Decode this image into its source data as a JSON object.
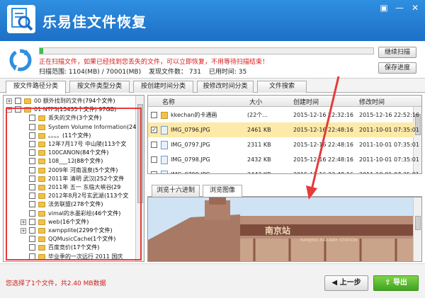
{
  "app": {
    "title": "乐易佳文件恢复"
  },
  "window_buttons": [
    "▣",
    "—",
    "✕"
  ],
  "scan": {
    "progress_percent": 1,
    "message": "正在扫描文件，如果已经找到您丢失的文件，可以立即恢复，不用等待扫描结束！",
    "scanned": "扫描范围: 1104(MB) / 70001(MB)",
    "found": "发现文件数：  731",
    "elapsed": "已用时间: 35",
    "btn_continue": "继续扫描",
    "btn_save": "保存进度"
  },
  "tabs": [
    "按文件路径分类",
    "按文件类型分类",
    "按创建时间分类",
    "按修改时间分类",
    "文件搜索"
  ],
  "tree": [
    {
      "indent": 0,
      "exp": "+",
      "label": "00  额外找到的文件",
      "count": "  (794个文件)"
    },
    {
      "indent": 0,
      "exp": "−",
      "label": "01  NTFS",
      "count": "  (15435个文件) 97GB)"
    },
    {
      "indent": 1,
      "exp": "",
      "label": "丢失的文件",
      "count": "  (3个文件)"
    },
    {
      "indent": 1,
      "exp": "",
      "label": "System Volume Information",
      "count": "  (24"
    },
    {
      "indent": 1,
      "exp": "",
      "label": "。。。。",
      "count": "  (11个文件)"
    },
    {
      "indent": 1,
      "exp": "",
      "label": "12年7月17号  中山陵",
      "count": "  (113个文"
    },
    {
      "indent": 1,
      "exp": "",
      "label": "100CANON",
      "count": "  (84个文件)"
    },
    {
      "indent": 1,
      "exp": "",
      "label": "108___12",
      "count": "  (88个文件)"
    },
    {
      "indent": 1,
      "exp": "",
      "label": "2009年 河南温泉",
      "count": "  (5个文件)"
    },
    {
      "indent": 1,
      "exp": "",
      "label": "2011年 清明  武汉",
      "count": "  (252个文件"
    },
    {
      "indent": 1,
      "exp": "",
      "label": "2011年 五一  东临大峡谷",
      "count": "  (29"
    },
    {
      "indent": 1,
      "exp": "",
      "label": "2012年8月2号玄武湖",
      "count": "  (113个文"
    },
    {
      "indent": 1,
      "exp": "",
      "label": "法务联盟",
      "count": "  (278个文件)"
    },
    {
      "indent": 1,
      "exp": "",
      "label": "vimal的水墨彩绘",
      "count": "  (46个文件)"
    },
    {
      "indent": 1,
      "exp": "+",
      "label": "web",
      "count": "  (16个文件)"
    },
    {
      "indent": 1,
      "exp": "+",
      "label": "xampplite",
      "count": "  (2299个文件)"
    },
    {
      "indent": 1,
      "exp": "",
      "label": "QQMusicCache",
      "count": "  (1个文件)"
    },
    {
      "indent": 1,
      "exp": "",
      "label": "百度竞价",
      "count": "  (17个文件)"
    },
    {
      "indent": 1,
      "exp": "",
      "label": "毕业季的一次远行 2011 国庆",
      "count": ""
    }
  ],
  "filelist": {
    "headers": [
      "名称",
      "大小",
      "创建时间",
      "修改时间"
    ],
    "rows": [
      {
        "name": "kkechan的卡通画",
        "size": "(22个...",
        "created": "2015-12-16  22:32:16",
        "modified": "2015-12-16  22:52:16",
        "type": "folder",
        "selected": false
      },
      {
        "name": "IMG_0796.JPG",
        "size": "2461 KB",
        "created": "2015-12-16  22:48:16",
        "modified": "2011-10-01  07:35:01",
        "type": "file",
        "selected": true
      },
      {
        "name": "IMG_0797.JPG",
        "size": "2311 KB",
        "created": "2015-12-16  22:48:16",
        "modified": "2011-10-01  07:35:01",
        "type": "file",
        "selected": false
      },
      {
        "name": "IMG_0798.JPG",
        "size": "2432 KB",
        "created": "2015-12-16  22:48:16",
        "modified": "2011-10-01  07:35:01",
        "type": "file",
        "selected": false
      },
      {
        "name": "IMG_0799.JPG",
        "size": "2442 KB",
        "created": "2015-12-16  22:48:16",
        "modified": "2011-10-01  07:35:01",
        "type": "file",
        "selected": false
      }
    ]
  },
  "preview_tabs": [
    "浏览十六进制",
    "浏览图像"
  ],
  "preview": {
    "sign_text": "南京站",
    "sub_text": "NANJING RAILWAY STATION"
  },
  "footer": {
    "status": "您选择了1个文件，共2.40 MB数据",
    "btn_prev": "上一步",
    "btn_export": "导出"
  },
  "colors": {
    "title_bar": "#1d6fc6",
    "highlight": "#fde9a8",
    "annotation": "#e53b3b",
    "export": "#3fa31e"
  }
}
